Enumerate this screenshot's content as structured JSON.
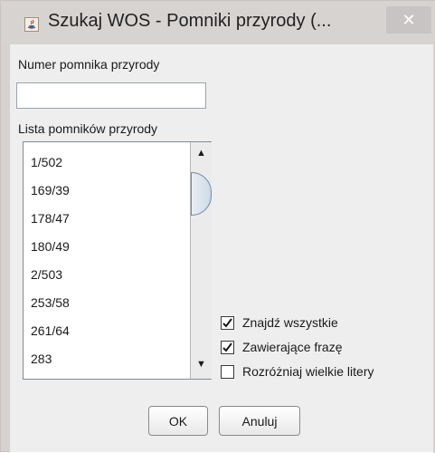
{
  "window": {
    "title": "Szukaj WOS - Pomniki przyrody (...",
    "close_glyph": "✕"
  },
  "form": {
    "number_label": "Numer pomnika przyrody",
    "number_value": "",
    "list_label": "Lista pomników przyrody"
  },
  "list": {
    "items": [
      "1/502",
      "169/39",
      "178/47",
      "180/49",
      "2/503",
      "253/58",
      "261/64",
      "283"
    ]
  },
  "options": [
    {
      "label": "Znajdź wszystkie",
      "checked": true
    },
    {
      "label": "Zawierające frazę",
      "checked": true
    },
    {
      "label": "Rozróżniaj wielkie litery",
      "checked": false
    }
  ],
  "buttons": {
    "ok_label": "OK",
    "cancel_label": "Anuluj"
  }
}
